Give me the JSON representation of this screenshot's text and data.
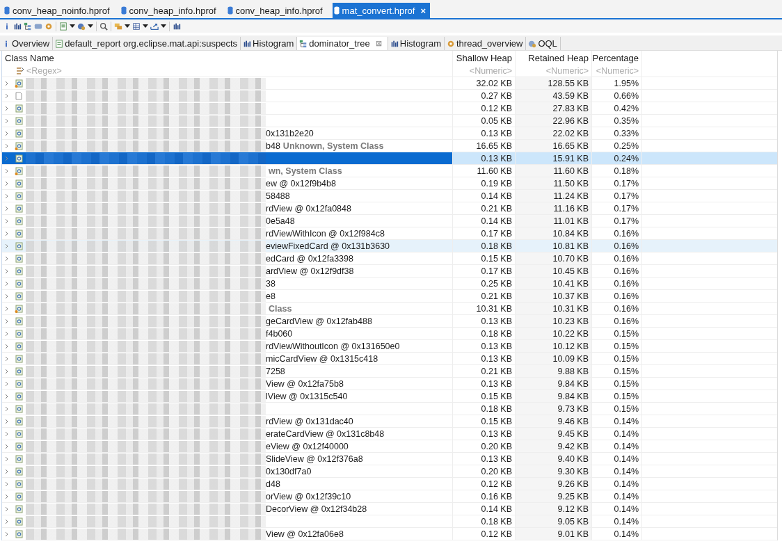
{
  "editor_tabs": [
    {
      "label": "conv_heap_noinfo.hprof",
      "selected": false
    },
    {
      "label": "conv_heap_info.hprof",
      "selected": false
    },
    {
      "label": "conv_heap_info.hprof",
      "selected": false
    },
    {
      "label": "mat_convert.hprof",
      "selected": true,
      "close": "×"
    }
  ],
  "view_tabs": [
    {
      "label": "Overview",
      "kind": "info",
      "selected": false
    },
    {
      "label": "default_report  org.eclipse.mat.api:suspects",
      "kind": "report",
      "selected": false
    },
    {
      "label": "Histogram",
      "kind": "bars",
      "selected": false
    },
    {
      "label": "dominator_tree",
      "kind": "tree",
      "selected": true,
      "close": "⊠"
    },
    {
      "label": "Histogram",
      "kind": "bars",
      "selected": false
    },
    {
      "label": "thread_overview",
      "kind": "gear",
      "selected": false
    },
    {
      "label": "OQL",
      "kind": "oql",
      "selected": false
    }
  ],
  "table": {
    "columns": [
      "Class Name",
      "Shallow Heap",
      "Retained Heap",
      "Percentage"
    ],
    "filters": [
      {
        "placeholder": "<Regex>"
      },
      {
        "placeholder": "<Numeric>"
      },
      {
        "placeholder": "<Numeric>"
      },
      {
        "placeholder": "<Numeric>"
      }
    ],
    "rows": [
      {
        "kind": "gc_root",
        "tail": "",
        "note": "",
        "shallow": "32.02 KB",
        "retained": "128.55 KB",
        "percentage": "1.95%",
        "selected": false,
        "hovered": false
      },
      {
        "kind": "file",
        "tail": "",
        "note": "",
        "shallow": "0.27 KB",
        "retained": "43.59 KB",
        "percentage": "0.66%",
        "selected": false,
        "hovered": false
      },
      {
        "kind": "object",
        "tail": "",
        "note": "",
        "shallow": "0.12 KB",
        "retained": "27.83 KB",
        "percentage": "0.42%",
        "selected": false,
        "hovered": false
      },
      {
        "kind": "object",
        "tail": "",
        "note": "",
        "shallow": "0.05 KB",
        "retained": "22.96 KB",
        "percentage": "0.35%",
        "selected": false,
        "hovered": false
      },
      {
        "kind": "object",
        "tail": "0x131b2e20",
        "note": "",
        "shallow": "0.13 KB",
        "retained": "22.02 KB",
        "percentage": "0.33%",
        "selected": false,
        "hovered": false
      },
      {
        "kind": "gc_root",
        "tail": "b48",
        "note": "Unknown, System Class",
        "shallow": "16.65 KB",
        "retained": "16.65 KB",
        "percentage": "0.25%",
        "selected": false,
        "hovered": false
      },
      {
        "kind": "object",
        "tail": "",
        "note": "",
        "shallow": "0.13 KB",
        "retained": "15.91 KB",
        "percentage": "0.24%",
        "selected": true,
        "hovered": false
      },
      {
        "kind": "gc_root",
        "tail": "",
        "note": "wn, System Class",
        "shallow": "11.60 KB",
        "retained": "11.60 KB",
        "percentage": "0.18%",
        "selected": false,
        "hovered": false
      },
      {
        "kind": "object",
        "tail": "ew @ 0x12f9b4b8",
        "note": "",
        "shallow": "0.19 KB",
        "retained": "11.50 KB",
        "percentage": "0.17%",
        "selected": false,
        "hovered": false
      },
      {
        "kind": "object",
        "tail": "58488",
        "note": "",
        "shallow": "0.14 KB",
        "retained": "11.24 KB",
        "percentage": "0.17%",
        "selected": false,
        "hovered": false
      },
      {
        "kind": "object",
        "tail": "rdView @ 0x12fa0848",
        "note": "",
        "shallow": "0.21 KB",
        "retained": "11.16 KB",
        "percentage": "0.17%",
        "selected": false,
        "hovered": false
      },
      {
        "kind": "object",
        "tail": "0e5a48",
        "note": "",
        "shallow": "0.14 KB",
        "retained": "11.01 KB",
        "percentage": "0.17%",
        "selected": false,
        "hovered": false
      },
      {
        "kind": "object",
        "tail": "rdViewWithIcon @ 0x12f984c8",
        "note": "",
        "shallow": "0.17 KB",
        "retained": "10.84 KB",
        "percentage": "0.16%",
        "selected": false,
        "hovered": false
      },
      {
        "kind": "object",
        "tail": "eviewFixedCard @ 0x131b3630",
        "note": "",
        "shallow": "0.18 KB",
        "retained": "10.81 KB",
        "percentage": "0.16%",
        "selected": false,
        "hovered": true
      },
      {
        "kind": "object",
        "tail": "edCard @ 0x12fa3398",
        "note": "",
        "shallow": "0.15 KB",
        "retained": "10.70 KB",
        "percentage": "0.16%",
        "selected": false,
        "hovered": false
      },
      {
        "kind": "object",
        "tail": "ardView @ 0x12f9df38",
        "note": "",
        "shallow": "0.17 KB",
        "retained": "10.45 KB",
        "percentage": "0.16%",
        "selected": false,
        "hovered": false
      },
      {
        "kind": "object",
        "tail": "38",
        "note": "",
        "shallow": "0.25 KB",
        "retained": "10.41 KB",
        "percentage": "0.16%",
        "selected": false,
        "hovered": false
      },
      {
        "kind": "object",
        "tail": "e8",
        "note": "",
        "shallow": "0.21 KB",
        "retained": "10.37 KB",
        "percentage": "0.16%",
        "selected": false,
        "hovered": false
      },
      {
        "kind": "gc_root",
        "tail": "",
        "note": "Class",
        "shallow": "10.31 KB",
        "retained": "10.31 KB",
        "percentage": "0.16%",
        "selected": false,
        "hovered": false
      },
      {
        "kind": "object",
        "tail": "geCardView @ 0x12fab488",
        "note": "",
        "shallow": "0.13 KB",
        "retained": "10.23 KB",
        "percentage": "0.16%",
        "selected": false,
        "hovered": false
      },
      {
        "kind": "object",
        "tail": "f4b060",
        "note": "",
        "shallow": "0.18 KB",
        "retained": "10.22 KB",
        "percentage": "0.15%",
        "selected": false,
        "hovered": false
      },
      {
        "kind": "object",
        "tail": "rdViewWithoutIcon @ 0x131650e0",
        "note": "",
        "shallow": "0.13 KB",
        "retained": "10.12 KB",
        "percentage": "0.15%",
        "selected": false,
        "hovered": false
      },
      {
        "kind": "object",
        "tail": "micCardView @ 0x1315c418",
        "note": "",
        "shallow": "0.13 KB",
        "retained": "10.09 KB",
        "percentage": "0.15%",
        "selected": false,
        "hovered": false
      },
      {
        "kind": "object",
        "tail": "7258",
        "note": "",
        "shallow": "0.21 KB",
        "retained": "9.88 KB",
        "percentage": "0.15%",
        "selected": false,
        "hovered": false
      },
      {
        "kind": "object",
        "tail": "View @ 0x12fa75b8",
        "note": "",
        "shallow": "0.13 KB",
        "retained": "9.84 KB",
        "percentage": "0.15%",
        "selected": false,
        "hovered": false
      },
      {
        "kind": "object",
        "tail": "lView @ 0x1315c540",
        "note": "",
        "shallow": "0.15 KB",
        "retained": "9.84 KB",
        "percentage": "0.15%",
        "selected": false,
        "hovered": false
      },
      {
        "kind": "object",
        "tail": "",
        "note": "",
        "shallow": "0.18 KB",
        "retained": "9.73 KB",
        "percentage": "0.15%",
        "selected": false,
        "hovered": false
      },
      {
        "kind": "object",
        "tail": "rdView @ 0x131dac40",
        "note": "",
        "shallow": "0.15 KB",
        "retained": "9.46 KB",
        "percentage": "0.14%",
        "selected": false,
        "hovered": false
      },
      {
        "kind": "object",
        "tail": "erateCardView @ 0x131c8b48",
        "note": "",
        "shallow": "0.13 KB",
        "retained": "9.45 KB",
        "percentage": "0.14%",
        "selected": false,
        "hovered": false
      },
      {
        "kind": "object",
        "tail": "eView @ 0x12f40000",
        "note": "",
        "shallow": "0.20 KB",
        "retained": "9.42 KB",
        "percentage": "0.14%",
        "selected": false,
        "hovered": false
      },
      {
        "kind": "object",
        "tail": "SlideView @ 0x12f376a8",
        "note": "",
        "shallow": "0.13 KB",
        "retained": "9.40 KB",
        "percentage": "0.14%",
        "selected": false,
        "hovered": false
      },
      {
        "kind": "object",
        "tail": "0x130df7a0",
        "note": "",
        "shallow": "0.20 KB",
        "retained": "9.30 KB",
        "percentage": "0.14%",
        "selected": false,
        "hovered": false
      },
      {
        "kind": "object",
        "tail": "d48",
        "note": "",
        "shallow": "0.12 KB",
        "retained": "9.26 KB",
        "percentage": "0.14%",
        "selected": false,
        "hovered": false
      },
      {
        "kind": "object",
        "tail": "orView @ 0x12f39c10",
        "note": "",
        "shallow": "0.16 KB",
        "retained": "9.25 KB",
        "percentage": "0.14%",
        "selected": false,
        "hovered": false
      },
      {
        "kind": "object",
        "tail": "DecorView @ 0x12f34b28",
        "note": "",
        "shallow": "0.14 KB",
        "retained": "9.12 KB",
        "percentage": "0.14%",
        "selected": false,
        "hovered": false
      },
      {
        "kind": "object",
        "tail": "",
        "note": "",
        "shallow": "0.18 KB",
        "retained": "9.05 KB",
        "percentage": "0.14%",
        "selected": false,
        "hovered": false
      },
      {
        "kind": "object",
        "tail": "View @ 0x12fa06e8",
        "note": "",
        "shallow": "0.12 KB",
        "retained": "9.01 KB",
        "percentage": "0.14%",
        "selected": false,
        "hovered": false
      }
    ]
  }
}
